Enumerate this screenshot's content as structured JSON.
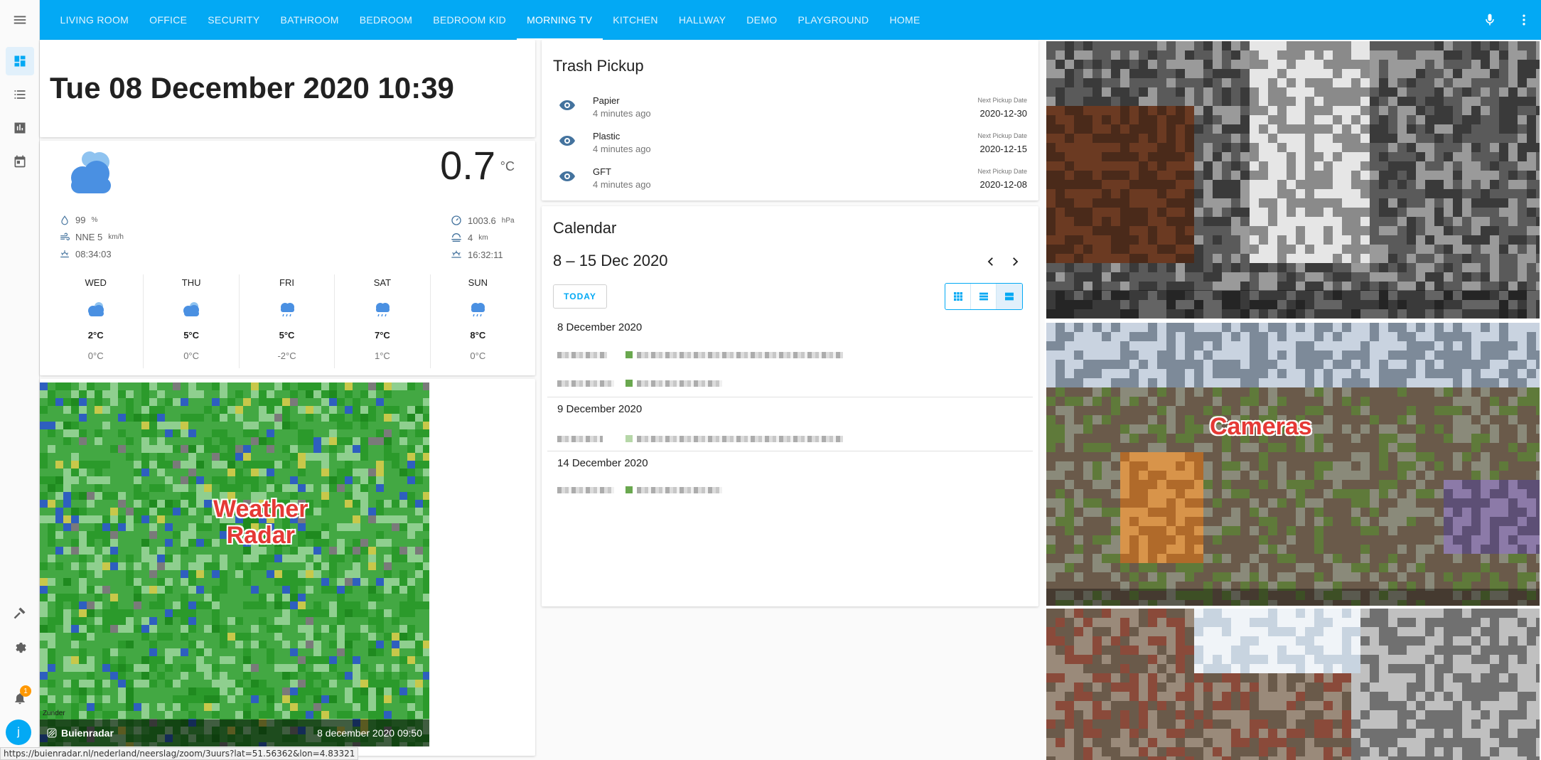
{
  "header": {
    "tabs": [
      "LIVING ROOM",
      "OFFICE",
      "SECURITY",
      "BATHROOM",
      "BEDROOM",
      "BEDROOM KID",
      "MORNING TV",
      "KITCHEN",
      "HALLWAY",
      "DEMO",
      "PLAYGROUND",
      "HOME"
    ],
    "active_tab": "MORNING TV"
  },
  "sidebar": {
    "notification_count": "1",
    "user_initial": "j"
  },
  "clock": {
    "text": "Tue 08 December 2020 10:39"
  },
  "weather": {
    "temperature": "0.7",
    "unit": "°C",
    "humidity": "99",
    "humidity_unit": "%",
    "wind": "NNE 5",
    "wind_unit": "km/h",
    "sunrise": "08:34:03",
    "pressure": "1003.6",
    "pressure_unit": "hPa",
    "visibility": "4",
    "visibility_unit": "km",
    "sunset": "16:32:11",
    "forecast": [
      {
        "day": "WED",
        "high": "2°C",
        "low": "0°C"
      },
      {
        "day": "THU",
        "high": "5°C",
        "low": "0°C"
      },
      {
        "day": "FRI",
        "high": "5°C",
        "low": "-2°C"
      },
      {
        "day": "SAT",
        "high": "7°C",
        "low": "1°C"
      },
      {
        "day": "SUN",
        "high": "8°C",
        "low": "0°C"
      }
    ]
  },
  "radar": {
    "brand": "Buienradar",
    "timestamp": "8 december 2020 09:50",
    "annotation_line1": "Weather",
    "annotation_line2": "Radar",
    "map_label": "Zunder"
  },
  "trash": {
    "title": "Trash Pickup",
    "next_label": "Next Pickup Date",
    "items": [
      {
        "name": "Papier",
        "ago": "4 minutes ago",
        "date": "2020-12-30"
      },
      {
        "name": "Plastic",
        "ago": "4 minutes ago",
        "date": "2020-12-15"
      },
      {
        "name": "GFT",
        "ago": "4 minutes ago",
        "date": "2020-12-08"
      }
    ]
  },
  "calendar": {
    "title": "Calendar",
    "range": "8 – 15 Dec 2020",
    "today_label": "TODAY",
    "days": [
      "8 December 2020",
      "9 December 2020",
      "14 December 2020"
    ]
  },
  "cameras": {
    "annotation": "Cameras"
  },
  "status_url": "https://buienradar.nl/nederland/neerslag/zoom/3uurs?lat=51.56362&lon=4.83321",
  "colors": {
    "accent": "#03a9f4",
    "weather_icon": "#5ba3e6",
    "annotation": "#e53935",
    "event_dot": "#6aa84f"
  }
}
